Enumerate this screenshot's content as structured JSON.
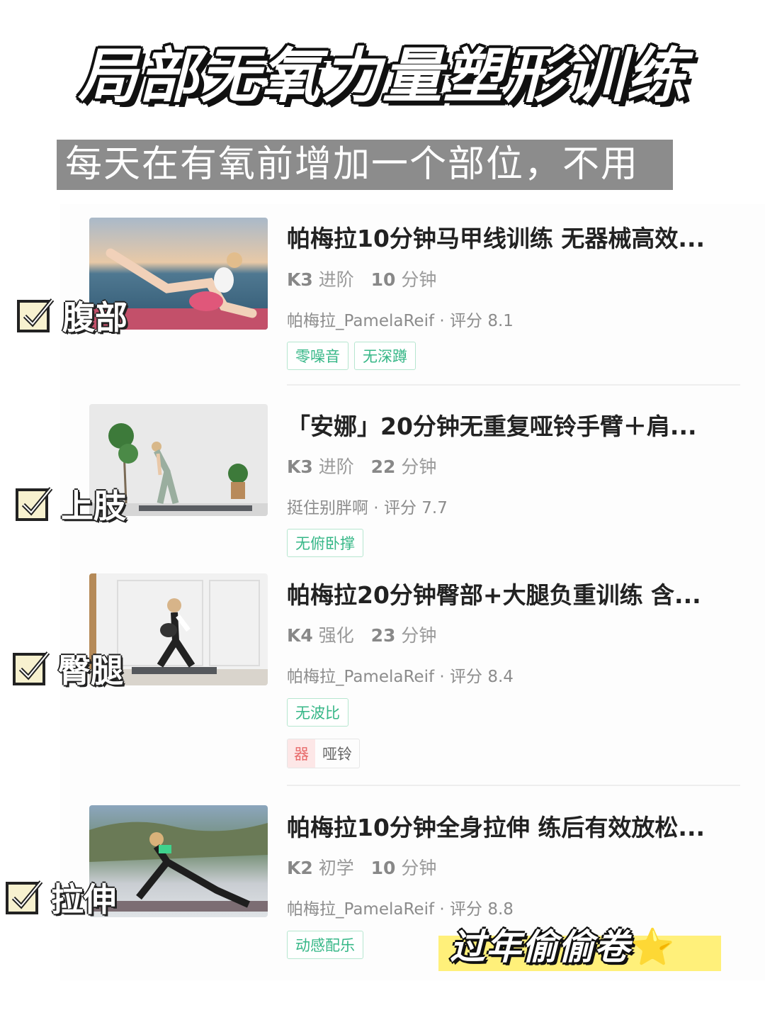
{
  "header": {
    "title": "局部无氧力量塑形训练",
    "subtitle": "每天在有氧前增加一个部位，不用多"
  },
  "workouts": [
    {
      "label": "腹部",
      "title": "帕梅拉10分钟马甲线训练 无器械高效...",
      "level": "K3",
      "level_name": "进阶",
      "duration": "10",
      "duration_unit": "分钟",
      "author": "帕梅拉_PamelaReif",
      "rating_label": "评分",
      "rating": "8.1",
      "tags": [
        "零噪音",
        "无深蹲"
      ]
    },
    {
      "label": "上肢",
      "title": "「安娜」20分钟无重复哑铃手臂＋肩...",
      "level": "K3",
      "level_name": "进阶",
      "duration": "22",
      "duration_unit": "分钟",
      "author": "挺住别胖啊",
      "rating_label": "评分",
      "rating": "7.7",
      "tags": [
        "无俯卧撑"
      ]
    },
    {
      "label": "臀腿",
      "title": "帕梅拉20分钟臀部+大腿负重训练 含...",
      "level": "K4",
      "level_name": "强化",
      "duration": "23",
      "duration_unit": "分钟",
      "author": "帕梅拉_PamelaReif",
      "rating_label": "评分",
      "rating": "8.4",
      "tags": [
        "无波比"
      ],
      "equipment_badge": "器",
      "equipment": "哑铃"
    },
    {
      "label": "拉伸",
      "title": "帕梅拉10分钟全身拉伸 练后有效放松...",
      "level": "K2",
      "level_name": "初学",
      "duration": "10",
      "duration_unit": "分钟",
      "author": "帕梅拉_PamelaReif",
      "rating_label": "评分",
      "rating": "8.8",
      "tags": [
        "动感配乐"
      ]
    }
  ],
  "stamp": {
    "text": "过年偷偷卷",
    "emoji": "⭐"
  },
  "colors": {
    "tag_green": "#36b787",
    "equip_red": "#e86a6a",
    "highlight_yellow": "#fff07a",
    "subtitle_bg": "#8c8c8c"
  }
}
